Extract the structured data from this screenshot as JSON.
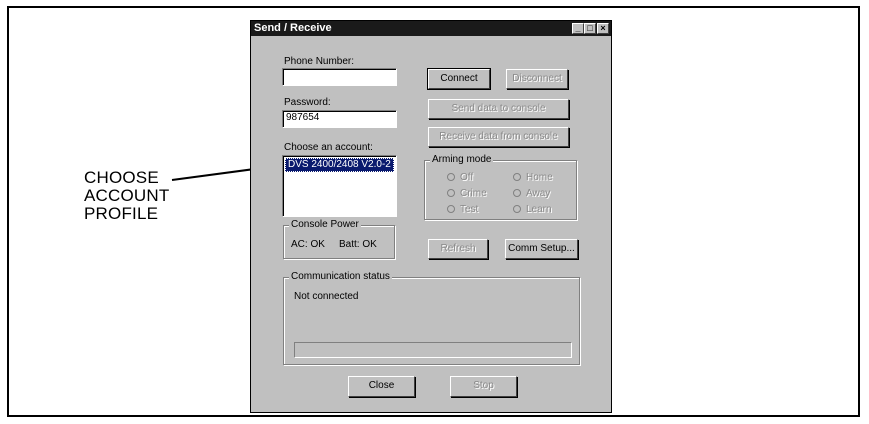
{
  "callout": {
    "lines": [
      "CHOOSE",
      "ACCOUNT",
      "PROFILE"
    ]
  },
  "window": {
    "title": "Send / Receive",
    "controls": {
      "minimize": "_",
      "maximize": "□",
      "close": "×"
    }
  },
  "phone": {
    "label": "Phone Number:",
    "value": ""
  },
  "password": {
    "label": "Password:",
    "value": "987654"
  },
  "account": {
    "label": "Choose an account:",
    "selected": "DVS 2400/2408 V2.0-2"
  },
  "buttons": {
    "connect": "Connect",
    "disconnect": "Disconnect",
    "send": "Send data to console",
    "receive": "Receive data from console",
    "refresh": "Refresh",
    "comm_setup": "Comm Setup...",
    "close": "Close",
    "stop": "Stop"
  },
  "arming": {
    "caption": "Arming mode",
    "options": [
      "Off",
      "Home",
      "Crime",
      "Away",
      "Test",
      "Learn"
    ]
  },
  "power": {
    "caption": "Console Power",
    "ac": "AC: OK",
    "batt": "Batt: OK"
  },
  "comm": {
    "caption": "Communication status",
    "status": "Not connected"
  }
}
